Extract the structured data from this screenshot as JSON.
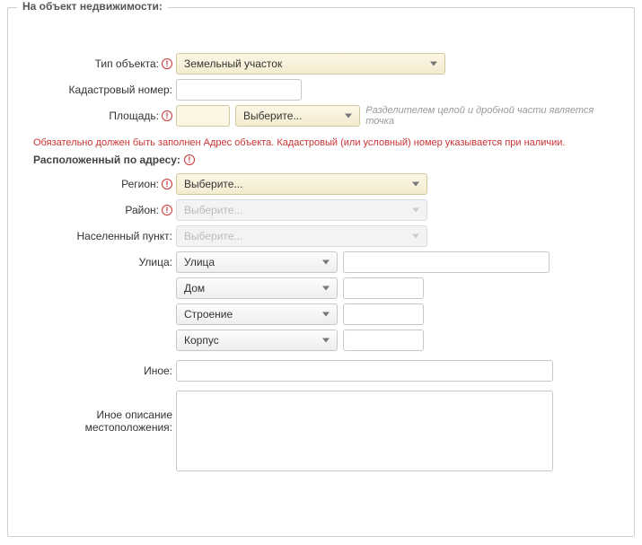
{
  "legend": "На объект недвижимости:",
  "labels": {
    "object_type": "Тип объекта:",
    "cad_number": "Кадастровый номер:",
    "area": "Площадь:",
    "region": "Регион:",
    "district": "Район:",
    "settlement": "Населенный пункт:",
    "street": "Улица:",
    "other": "Иное:",
    "other_desc_1": "Иное описание",
    "other_desc_2": "местоположения:"
  },
  "values": {
    "object_type": "Земельный участок",
    "cad_number": "",
    "area_value": "",
    "area_unit": "Выберите...",
    "region": "Выберите...",
    "district": "Выберите...",
    "settlement": "Выберите...",
    "street_type": "Улица",
    "street_name": "",
    "house_type": "Дом",
    "house_num": "",
    "building_type": "Строение",
    "building_num": "",
    "block_type": "Корпус",
    "block_num": "",
    "other": "",
    "other_desc": ""
  },
  "hints": {
    "area": "Разделителем целой и дробной части является точка"
  },
  "warning": "Обязательно должен быть заполнен Адрес объекта. Кадастровый (или условный) номер указывается при наличии.",
  "subheader": "Расположенный по адресу:",
  "req_glyph": "!"
}
